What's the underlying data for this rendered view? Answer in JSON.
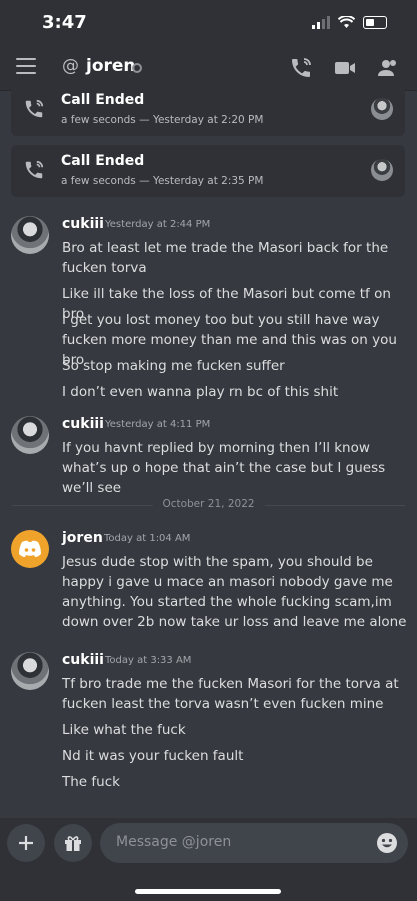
{
  "status_bar": {
    "time": "3:47"
  },
  "header": {
    "at_symbol": "@",
    "title": "joren"
  },
  "calls": [
    {
      "title": "Call Ended",
      "subtitle": "a few seconds — Yesterday at 2:20 PM"
    },
    {
      "title": "Call Ended",
      "subtitle": "a few seconds — Yesterday at 2:35 PM"
    }
  ],
  "messages": [
    {
      "author": "cukiii",
      "timestamp": "Yesterday at 2:44 PM",
      "lines": [
        "Bro at least let me trade the Masori back for the fucken torva",
        "Like ill take the loss of the Masori but come tf on bro",
        "I get you lost money too but you still have way fucken more money than me and this was on you bro",
        "So stop making me fucken suffer",
        "I don’t even wanna play rn bc of this shit"
      ]
    },
    {
      "author": "cukiii",
      "timestamp": "Yesterday at 4:11 PM",
      "lines": [
        "If you havnt replied by morning then I’ll know what’s up o hope that ain’t the case but I guess we’ll see"
      ]
    },
    {
      "author": "joren",
      "timestamp": "Today at 1:04 AM",
      "lines": [
        "Jesus dude stop with the spam, you should be happy i gave u mace an masori nobody gave me anything. You started the whole fucking scam,im down over 2b now take ur loss and leave me alone"
      ]
    },
    {
      "author": "cukiii",
      "timestamp": "Today at 3:33 AM",
      "lines": [
        "Tf bro trade me the fucken Masori for the torva at fucken least the torva wasn’t even fucken mine",
        "Like what the fuck",
        "Nd it was your fucken fault",
        "The fuck"
      ]
    }
  ],
  "date_divider": "October 21, 2022",
  "composer": {
    "placeholder": "Message @joren"
  },
  "colors": {
    "background": "#36393f",
    "panel": "#2f3136",
    "discord_avatar": "#f0a32a"
  }
}
